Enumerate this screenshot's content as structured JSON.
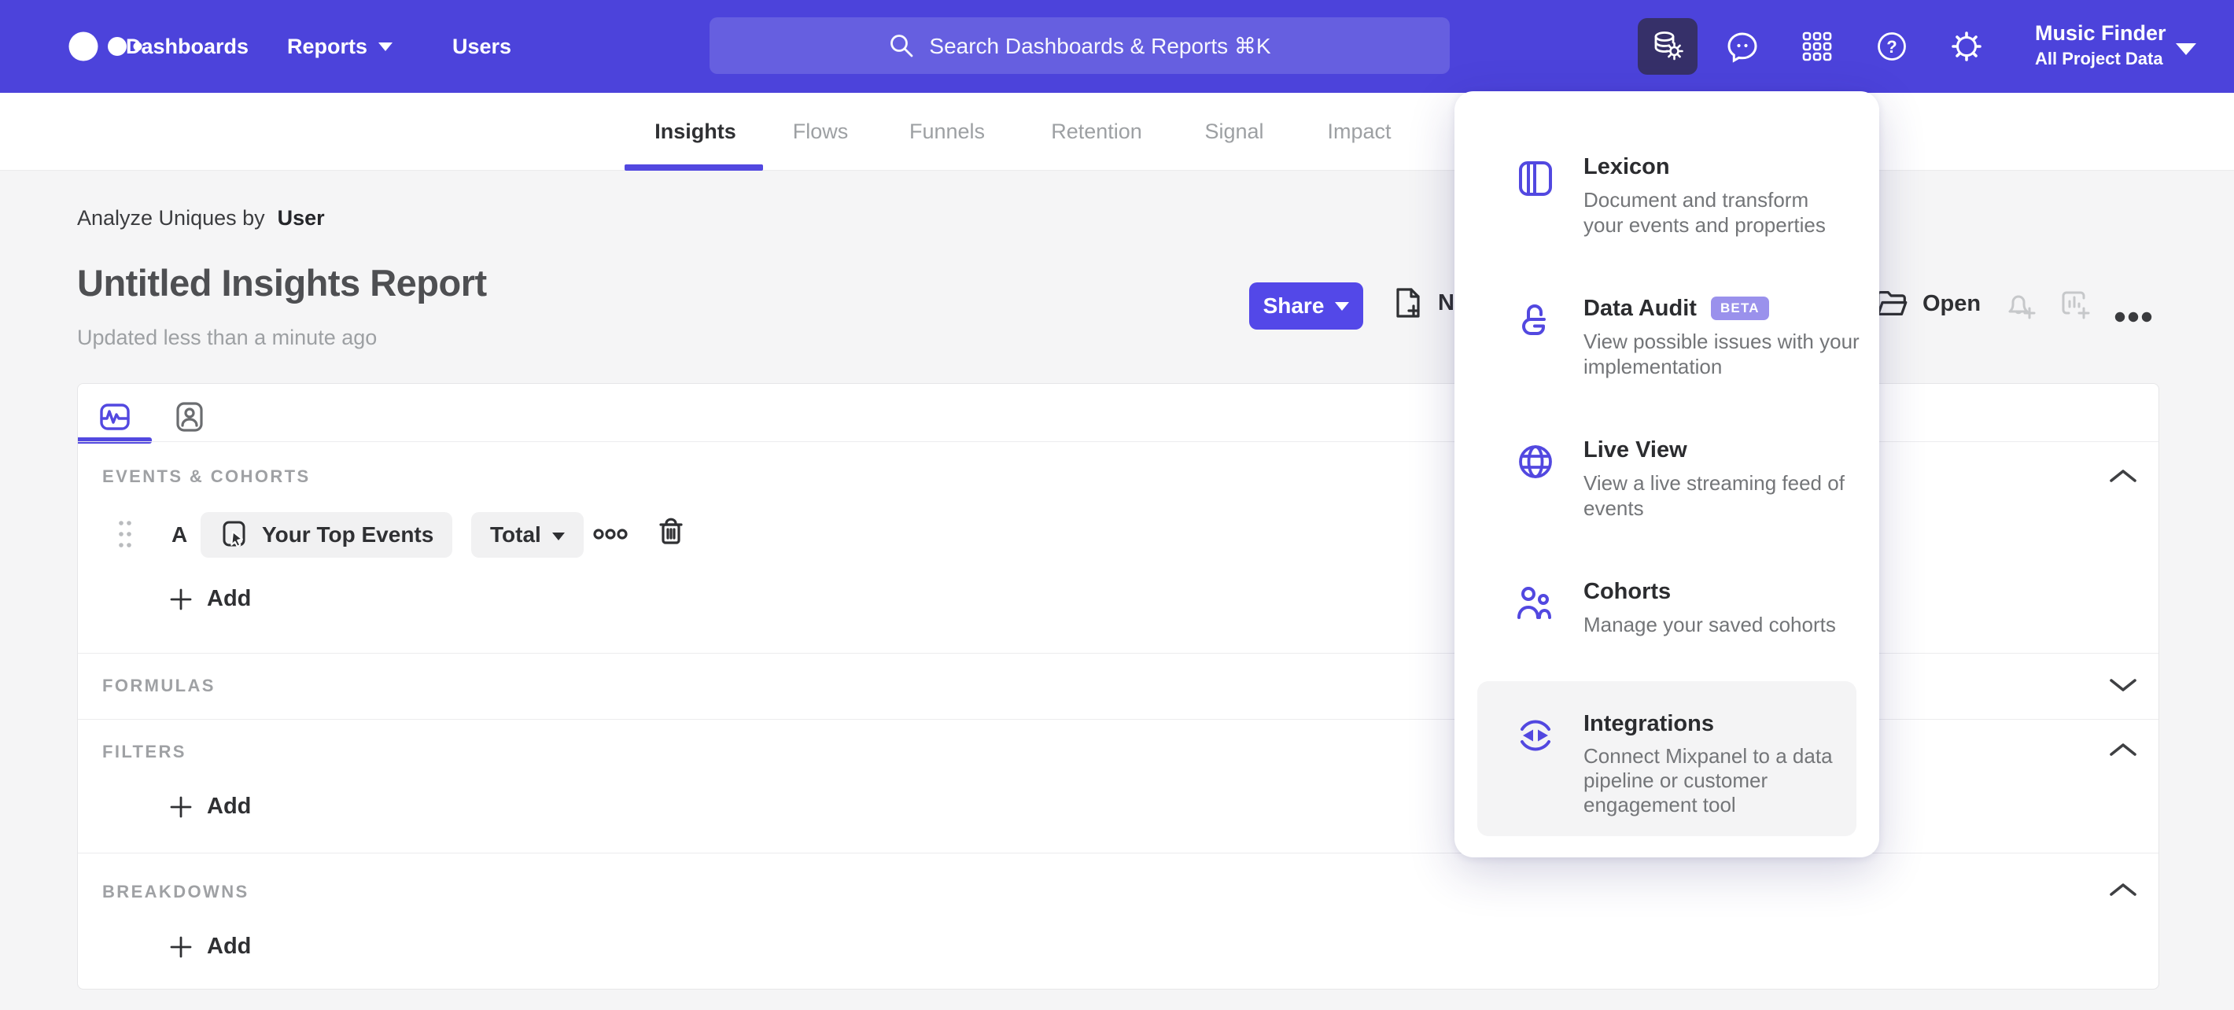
{
  "nav": {
    "items": [
      "Dashboards",
      "Reports",
      "Users"
    ],
    "search": {
      "placeholder": "Search Dashboards & Reports ⌘K"
    },
    "project": {
      "name": "Music Finder",
      "scope": "All Project Data"
    }
  },
  "tabs": {
    "items": [
      "Insights",
      "Flows",
      "Funnels",
      "Retention",
      "Signal",
      "Impact"
    ],
    "active": "Insights"
  },
  "header": {
    "analyze_label": "Analyze Uniques by",
    "analyze_entity": "User",
    "title": "Untitled Insights Report",
    "updated": "Updated less than a minute ago",
    "share": "Share",
    "new": "New",
    "open": "Open"
  },
  "builder": {
    "events_section": "EVENTS & COHORTS",
    "row_letter": "A",
    "event_name": "Your Top Events",
    "metric": "Total",
    "add": "Add",
    "formulas_section": "FORMULAS",
    "filters_section": "FILTERS",
    "breakdowns_section": "BREAKDOWNS"
  },
  "menu": {
    "items": [
      {
        "title": "Lexicon",
        "desc": "Document and transform\nyour events and properties"
      },
      {
        "title": "Data Audit",
        "badge": "BETA",
        "desc": "View possible issues with your\nimplementation"
      },
      {
        "title": "Live View",
        "desc": "View a live streaming feed of\nevents"
      },
      {
        "title": "Cohorts",
        "desc": "Manage your saved cohorts"
      },
      {
        "title": "Integrations",
        "desc": "Connect Mixpanel to a data\npipeline or customer\nengagement tool"
      }
    ]
  },
  "colors": {
    "nav": "#4C43DB",
    "accent": "#5248E0",
    "active_tile": "#363069",
    "beta_badge": "#9A91EC",
    "page_bg": "#f5f5f6"
  }
}
